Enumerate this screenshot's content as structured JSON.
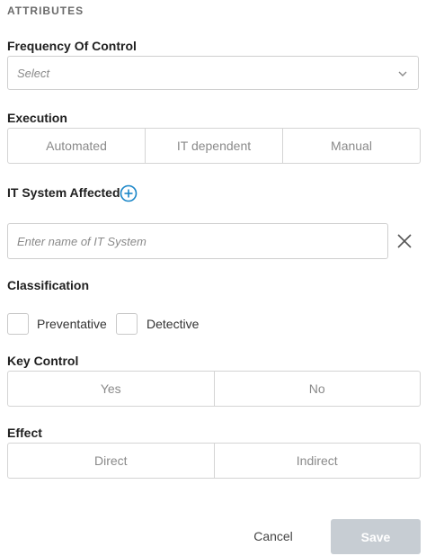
{
  "section_title": "ATTRIBUTES",
  "frequency": {
    "label": "Frequency Of Control",
    "placeholder": "Select",
    "chevron_icon": "chevron-down-icon"
  },
  "execution": {
    "label": "Execution",
    "options": [
      "Automated",
      "IT dependent",
      "Manual"
    ]
  },
  "it_system": {
    "label": "IT System Affected",
    "add_icon": "plus-circle-icon",
    "add_icon_color": "#1a86c8",
    "input_placeholder": "Enter name of IT System",
    "remove_icon": "close-icon"
  },
  "classification": {
    "label": "Classification",
    "options": [
      "Preventative",
      "Detective"
    ]
  },
  "key_control": {
    "label": "Key Control",
    "options": [
      "Yes",
      "No"
    ]
  },
  "effect": {
    "label": "Effect",
    "options": [
      "Direct",
      "Indirect"
    ]
  },
  "actions": {
    "cancel": "Cancel",
    "save": "Save",
    "save_color": "#c7cdd3"
  }
}
